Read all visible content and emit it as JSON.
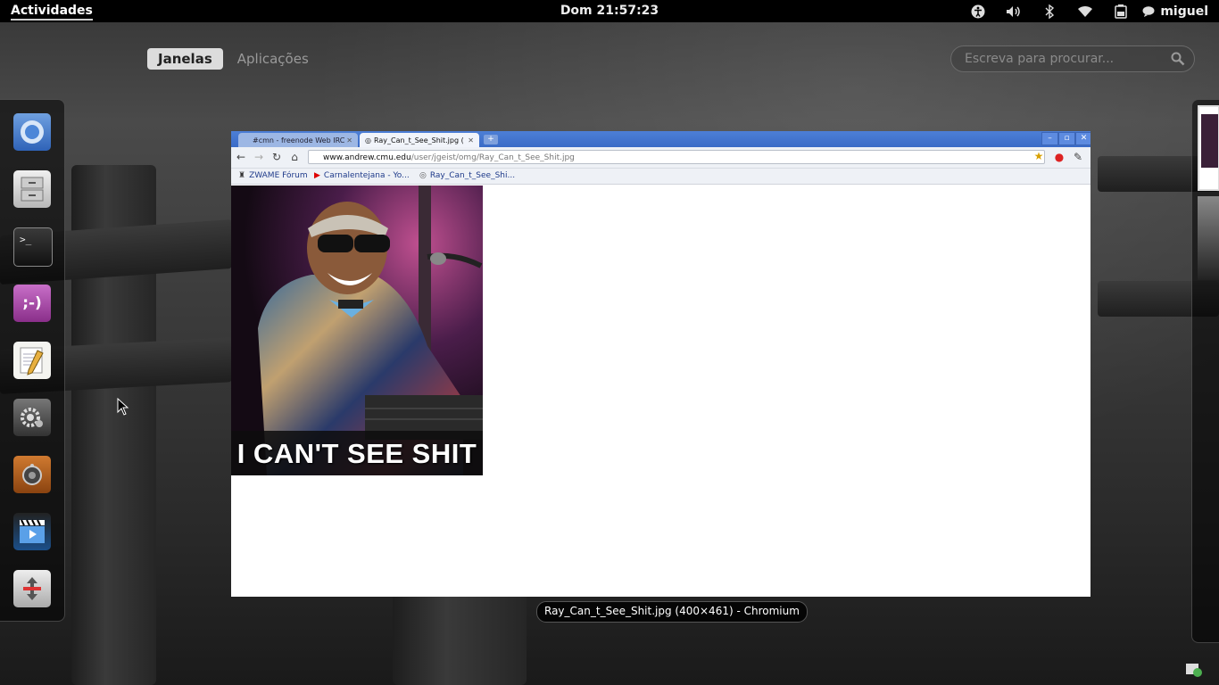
{
  "topbar": {
    "activities": "Actividades",
    "clock": "Dom 21:57:23",
    "user": "miguel",
    "status_icons": [
      "accessibility-icon",
      "volume-icon",
      "bluetooth-icon",
      "wifi-icon",
      "battery-icon"
    ]
  },
  "overview": {
    "tabs": [
      {
        "label": "Janelas",
        "active": true
      },
      {
        "label": "Aplicações",
        "active": false
      }
    ],
    "search_placeholder": "Escreva para procurar..."
  },
  "dash": {
    "apps": [
      "chromium",
      "files",
      "terminal",
      "empathy",
      "gedit",
      "settings",
      "rhythmbox",
      "totem",
      "utility"
    ]
  },
  "browser": {
    "tabs": [
      {
        "label": "#cmn - freenode Web IRC",
        "active": false
      },
      {
        "label": "Ray_Can_t_See_Shit.jpg (",
        "active": true
      }
    ],
    "url_host": "www.andrew.cmu.edu",
    "url_path": "/user/jgeist/omg/Ray_Can_t_See_Shit.jpg",
    "bookmarks": [
      "ZWAME Fórum",
      "Carnalentejana - Yo...",
      "Ray_Can_t_See_Shi..."
    ],
    "image_caption": "I CAN'T SEE SHIT"
  },
  "window_label": "Ray_Can_t_See_Shit.jpg (400×461) - Chromium",
  "colors": {
    "chrome_blue": "#4d7fd6",
    "panel": "#000000"
  }
}
